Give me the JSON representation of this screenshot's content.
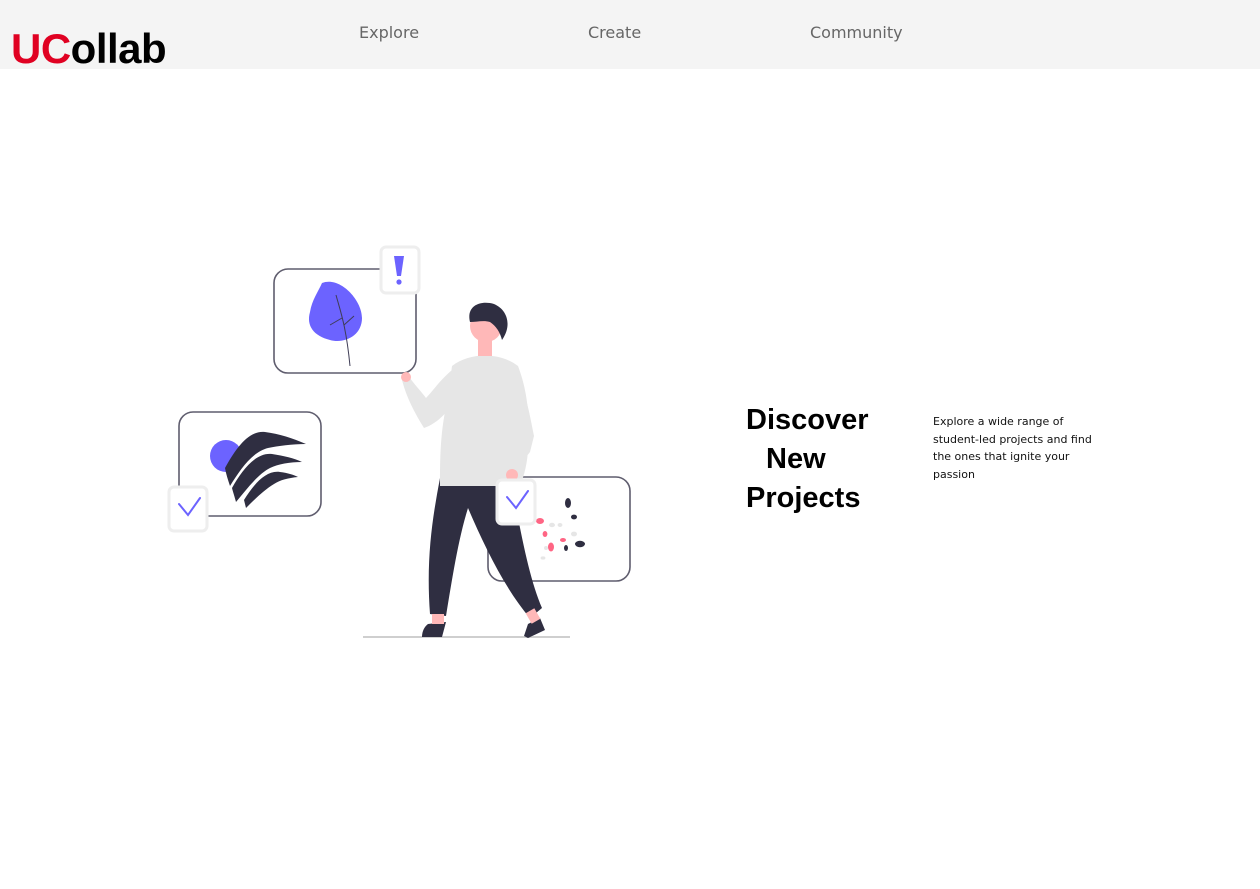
{
  "header": {
    "logo_uc": "UC",
    "logo_rest": "ollab",
    "nav": [
      {
        "label": "Explore"
      },
      {
        "label": "Create"
      },
      {
        "label": "Community"
      }
    ]
  },
  "hero": {
    "title_lines": [
      "Discover",
      "New",
      "Projects"
    ],
    "description": "Explore a wide range of student-led projects and find the ones that ignite your passion"
  },
  "colors": {
    "brand_red": "#e00122",
    "accent_purple": "#6c63ff",
    "header_bg": "#f4f4f4",
    "dark_figure": "#2f2e41",
    "highlight_pink": "#ff6584"
  },
  "icons": [
    "exclamation-icon",
    "check-icon",
    "leaf-icon"
  ]
}
